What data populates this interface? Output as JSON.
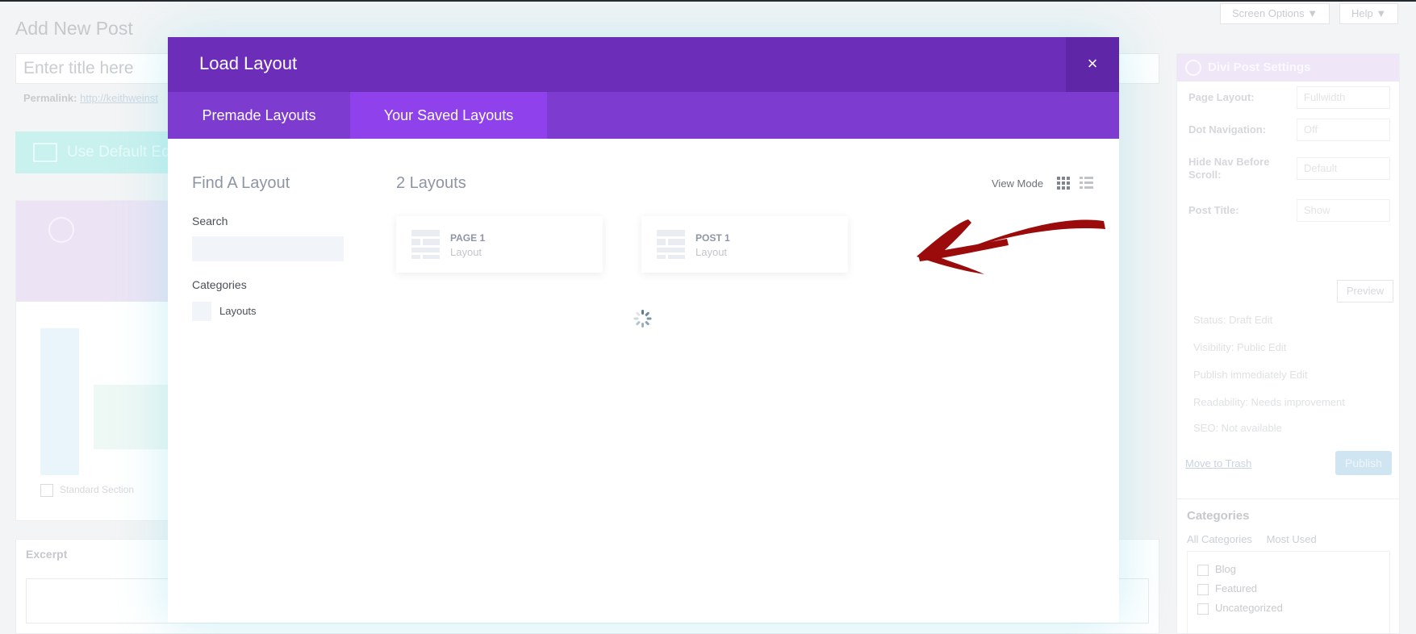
{
  "background": {
    "page_title": "Add New Post",
    "title_placeholder": "Enter title here",
    "permalink_label": "Permalink:",
    "permalink_url": "http://keithweinst",
    "use_default_button": "Use Default Ed",
    "screen_options": "Screen Options ▼",
    "help": "Help ▼",
    "standard_section": "Standard Section",
    "excerpt_label": "Excerpt",
    "divi_settings": {
      "title": "Divi Post Settings",
      "rows": [
        {
          "label": "Page Layout:",
          "value": "Fullwidth"
        },
        {
          "label": "Dot Navigation:",
          "value": "Off"
        },
        {
          "label": "Hide Nav Before Scroll:",
          "value": "Default"
        },
        {
          "label": "Post Title:",
          "value": "Show"
        }
      ],
      "publish_lines": [
        "Status: Draft Edit",
        "Visibility: Public Edit",
        "Publish immediately Edit",
        "Readability: Needs improvement",
        "SEO: Not available"
      ],
      "preview": "Preview",
      "trash": "Move to Trash",
      "publish": "Publish"
    },
    "categories": {
      "title": "Categories",
      "tabs": [
        "All Categories",
        "Most Used"
      ],
      "items": [
        "Blog",
        "Featured",
        "Uncategorized"
      ]
    }
  },
  "modal": {
    "title": "Load Layout",
    "close_symbol": "×",
    "tabs": [
      {
        "label": "Premade Layouts",
        "active": false
      },
      {
        "label": "Your Saved Layouts",
        "active": true
      }
    ],
    "sidebar": {
      "title": "Find A Layout",
      "search_label": "Search",
      "search_value": "",
      "categories_label": "Categories",
      "categories": [
        "Layouts"
      ]
    },
    "main": {
      "count_title": "2 Layouts",
      "view_mode_label": "View Mode",
      "layouts": [
        {
          "name": "PAGE 1",
          "type": "Layout"
        },
        {
          "name": "POST 1",
          "type": "Layout"
        }
      ]
    },
    "annotation_color": "#9b0b0b"
  },
  "colors": {
    "header": "#6c2eb9",
    "tabs": "#7e3bd0",
    "active_tab": "#8f42ec"
  }
}
